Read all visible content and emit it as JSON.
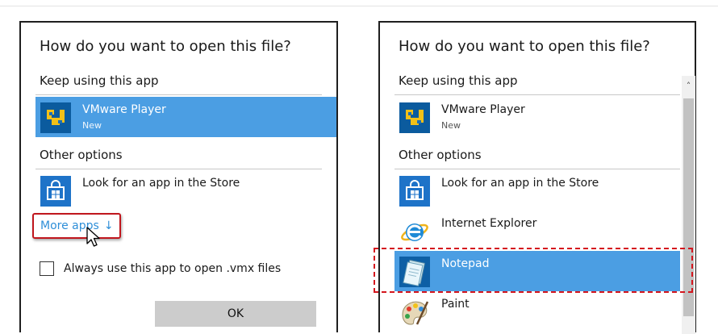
{
  "colors": {
    "selected": "#4b9ee3",
    "link": "#2f8fd8",
    "highlight": "#d4161e"
  },
  "left_dialog": {
    "title": "How do you want to open this file?",
    "keep_using_label": "Keep using this app",
    "current_app": {
      "name": "VMware Player",
      "sub": "New",
      "icon": "vmware-icon"
    },
    "other_options_label": "Other options",
    "store_option": {
      "name": "Look for an app in the Store",
      "icon": "store-icon"
    },
    "more_apps_label": "More apps",
    "more_apps_arrow": "↓",
    "always_use_label": "Always use this app to open .vmx files",
    "ok_label": "OK"
  },
  "right_dialog": {
    "title": "How do you want to open this file?",
    "keep_using_label": "Keep using this app",
    "current_app": {
      "name": "VMware Player",
      "sub": "New",
      "icon": "vmware-icon"
    },
    "other_options_label": "Other options",
    "store_option": {
      "name": "Look for an app in the Store",
      "icon": "store-icon"
    },
    "apps": [
      {
        "name": "Internet Explorer",
        "icon": "internet-explorer-icon"
      },
      {
        "name": "Notepad",
        "icon": "notepad-icon"
      },
      {
        "name": "Paint",
        "icon": "paint-icon"
      }
    ],
    "scroll_up_glyph": "˄"
  }
}
